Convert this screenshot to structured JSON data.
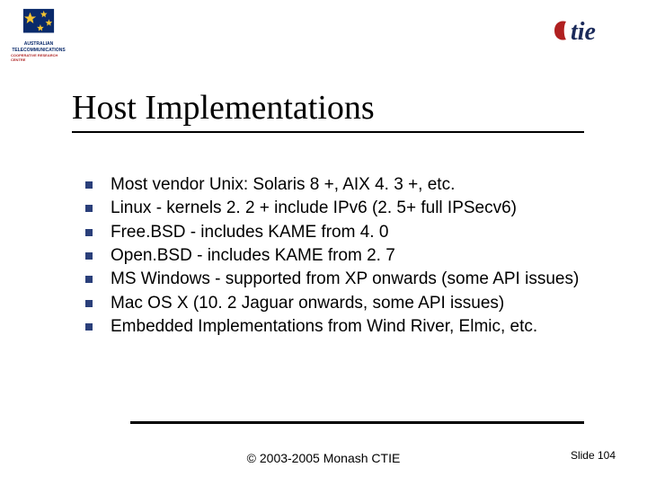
{
  "logos": {
    "left_line1": "AUSTRALIAN",
    "left_line2": "TELECOMMUNICATIONS",
    "left_sub": "COOPERATIVE RESEARCH CENTRE",
    "right_label": "tie"
  },
  "title": "Host Implementations",
  "bullets": [
    "Most vendor Unix: Solaris 8 +, AIX 4. 3 +, etc.",
    "Linux - kernels 2. 2 + include IPv6 (2. 5+ full IPSecv6)",
    "Free.BSD - includes KAME from 4. 0",
    "Open.BSD - includes KAME from 2. 7",
    "MS Windows - supported from XP onwards (some API issues)",
    "Mac OS X (10. 2 Jaguar onwards, some API issues)",
    "Embedded Implementations from Wind River, Elmic, etc."
  ],
  "footer": {
    "copyright": "© 2003-2005 Monash CTIE",
    "slide": "Slide 104"
  }
}
